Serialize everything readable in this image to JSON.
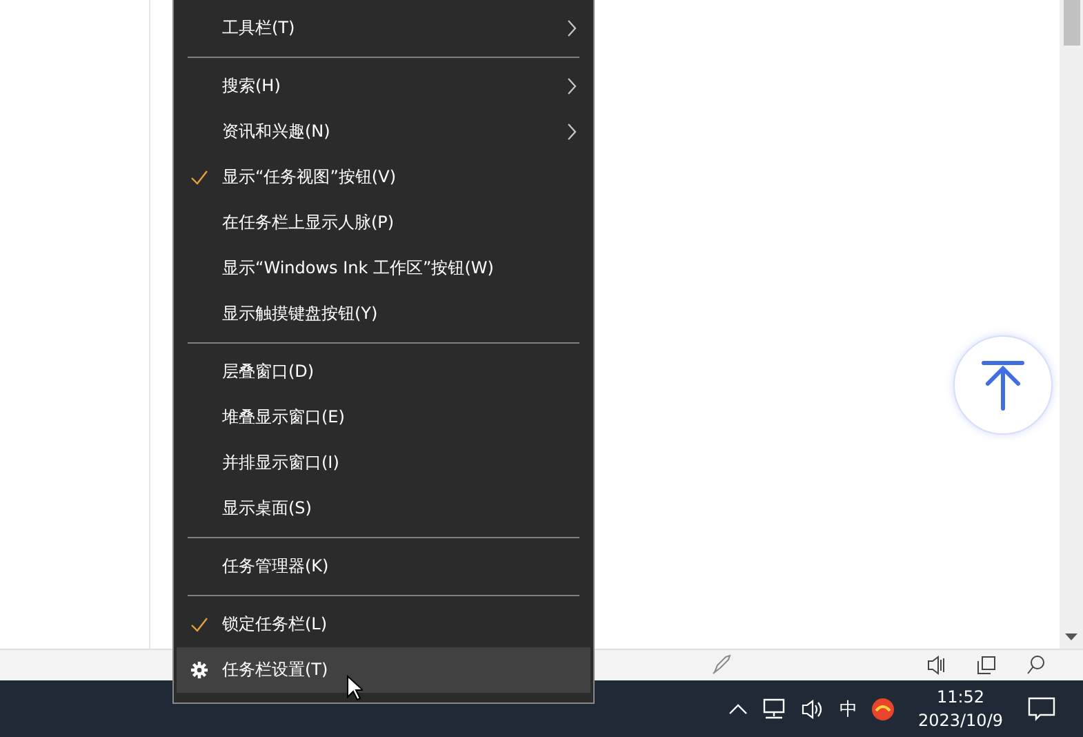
{
  "context_menu": {
    "sections": [
      [
        {
          "label": "工具栏(T)",
          "kind": "submenu",
          "selected": false
        }
      ],
      [
        {
          "label": "搜索(H)",
          "kind": "submenu",
          "selected": false
        },
        {
          "label": "资讯和兴趣(N)",
          "kind": "submenu",
          "selected": false
        },
        {
          "label": "显示“任务视图”按钮(V)",
          "kind": "check",
          "checked": true,
          "selected": false
        },
        {
          "label": "在任务栏上显示人脉(P)",
          "kind": "check",
          "checked": false,
          "selected": false
        },
        {
          "label": "显示“Windows Ink 工作区”按钮(W)",
          "kind": "check",
          "checked": false,
          "selected": false
        },
        {
          "label": "显示触摸键盘按钮(Y)",
          "kind": "check",
          "checked": false,
          "selected": false
        }
      ],
      [
        {
          "label": "层叠窗口(D)",
          "kind": "command",
          "selected": false
        },
        {
          "label": "堆叠显示窗口(E)",
          "kind": "command",
          "selected": false
        },
        {
          "label": "并排显示窗口(I)",
          "kind": "command",
          "selected": false
        },
        {
          "label": "显示桌面(S)",
          "kind": "command",
          "selected": false
        }
      ],
      [
        {
          "label": "任务管理器(K)",
          "kind": "command",
          "selected": false
        }
      ],
      [
        {
          "label": "锁定任务栏(L)",
          "kind": "check",
          "checked": true,
          "selected": false
        },
        {
          "label": "任务栏设置(T)",
          "kind": "settings",
          "selected": true
        }
      ]
    ]
  },
  "taskbar": {
    "ime": "中",
    "time": "11:52",
    "date": "2023/10/9"
  }
}
